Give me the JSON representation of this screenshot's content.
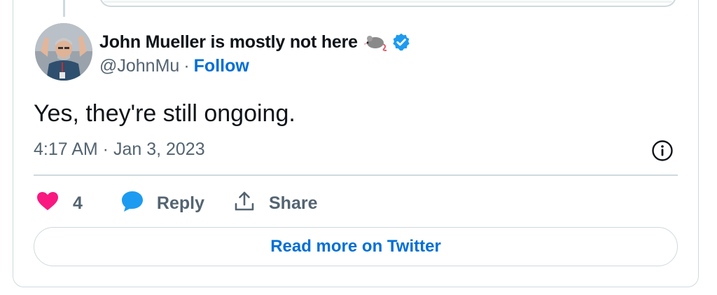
{
  "author": {
    "name": "John Mueller is mostly not here",
    "handle": "@JohnMu",
    "separator": "·",
    "follow_label": "Follow",
    "avatar_icon": "person-photo-avatar",
    "badge_icon": "verified-badge-icon",
    "emoji_icon": "mouse-icon"
  },
  "tweet": {
    "text": "Yes, they're still ongoing.",
    "timestamp": "4:17 AM · Jan 3, 2023"
  },
  "actions": {
    "like_count": "4",
    "reply_label": "Reply",
    "share_label": "Share"
  },
  "read_more_label": "Read more on Twitter",
  "colors": {
    "like": "#f91880",
    "reply": "#1d9bf0",
    "link": "#006fd6",
    "verified": "#1d9bf0",
    "muted": "#536471",
    "border": "#cfd9de"
  }
}
